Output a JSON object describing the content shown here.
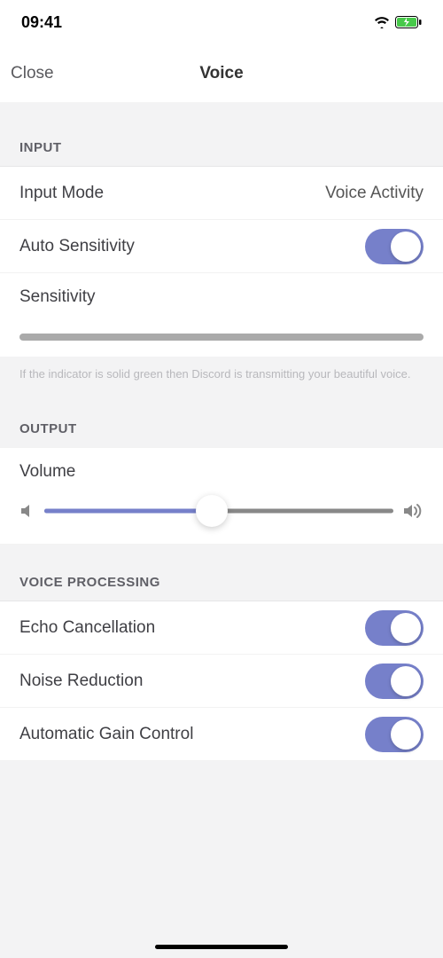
{
  "status": {
    "time": "09:41"
  },
  "nav": {
    "close": "Close",
    "title": "Voice"
  },
  "sections": {
    "input": {
      "header": "INPUT",
      "inputModeLabel": "Input Mode",
      "inputModeValue": "Voice Activity",
      "autoSensitivityLabel": "Auto Sensitivity",
      "autoSensitivityOn": true,
      "sensitivityLabel": "Sensitivity",
      "footer": "If the indicator is solid green then Discord is transmitting your beautiful voice."
    },
    "output": {
      "header": "OUTPUT",
      "volumeLabel": "Volume",
      "volumePercent": 48
    },
    "voiceProcessing": {
      "header": "VOICE PROCESSING",
      "echoLabel": "Echo Cancellation",
      "echoOn": true,
      "noiseLabel": "Noise Reduction",
      "noiseOn": true,
      "agcLabel": "Automatic Gain Control",
      "agcOn": true
    }
  }
}
